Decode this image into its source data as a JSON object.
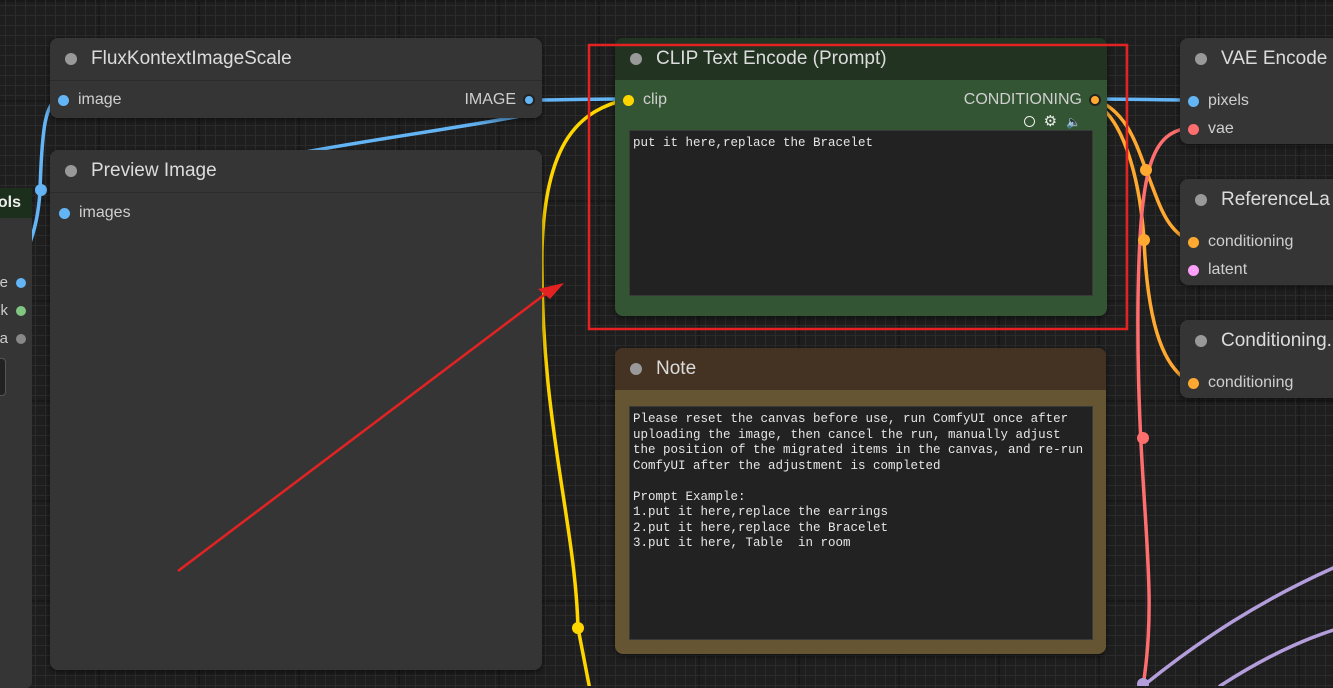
{
  "nodes": {
    "flux_scale": {
      "title": "FluxKontextImageScale",
      "input": "image",
      "output": "IMAGE"
    },
    "preview": {
      "title": "Preview Image",
      "input": "images"
    },
    "clip": {
      "title": "CLIP Text Encode (Prompt)",
      "input": "clip",
      "output": "CONDITIONING",
      "text": "put it here,replace the Bracelet"
    },
    "note": {
      "title": "Note",
      "text": "Please reset the canvas before use, run ComfyUI once after uploading the image, then cancel the run, manually adjust the position of the migrated items in the canvas, and re-run ComfyUI after the adjustment is completed\n\nPrompt Example:\n1.put it here,replace the earrings\n2.put it here,replace the Bracelet\n3.put it here, Table  in room"
    },
    "vae_encode": {
      "title": "VAE Encode",
      "inputs": [
        "pixels",
        "vae"
      ]
    },
    "reference_latent": {
      "title": "ReferenceLa",
      "inputs": [
        "conditioning",
        "latent"
      ]
    },
    "conditioning_node": {
      "title": "Conditioning.",
      "inputs": [
        "conditioning"
      ]
    },
    "left_partial": {
      "title": "ols",
      "slots": [
        "e",
        "k",
        "a"
      ]
    }
  },
  "colors": {
    "image": "#64b5f6",
    "clip": "#ffd500",
    "conditioning": "#ffa931",
    "vae": "#ff6e6e",
    "latent": "#ff9cf9",
    "mask": "#81c784",
    "grey_slot": "#888888",
    "clip_node_body": "#335533",
    "clip_node_title": "#223322",
    "note_node_body": "#665533",
    "note_node_title": "#443322",
    "highlight": "#e52222"
  }
}
